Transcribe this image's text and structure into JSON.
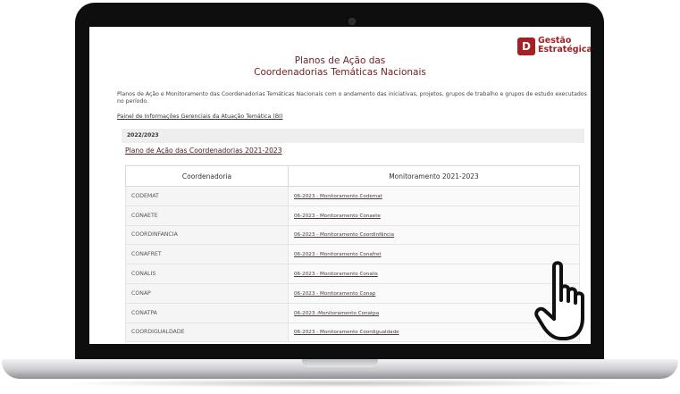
{
  "header": {
    "title_line1": "Planos de Ação das",
    "title_line2": "Coordenadorias Temáticas Nacionais",
    "logo_line1": "Gestão",
    "logo_line2": "Estratégica",
    "logo_mark": "D"
  },
  "intro": {
    "text": "Planos de Ação e Monitoramento das Coordenadorias Temáticas Nacionais com o andamento das iniciativas, projetos, grupos de trabalho e grupos de estudo executados no período.",
    "panel_link": "Painel de Informações Gerenciais da Atuação Temática (BI)"
  },
  "section": {
    "year": "2022/2023",
    "plan_link": "Plano de Ação das Coordenadorias 2021-2023"
  },
  "table": {
    "headers": [
      "Coordenadoria",
      "Monitoramento 2021-2023"
    ],
    "rows": [
      {
        "name": "CODEMAT",
        "link": "06-2023 - Monitoramento Codemat"
      },
      {
        "name": "CONAETE",
        "link": "06-2023 - Monitoramento Conaete"
      },
      {
        "name": "COORDINFANCIA",
        "link": "06-2023 - Monitoramento Coordinfância"
      },
      {
        "name": "CONAFRET",
        "link": "06-2023 - Monitoramento Conafret"
      },
      {
        "name": "CONALIS",
        "link": "06-2023 - Monitoramento Conalis"
      },
      {
        "name": "CONAP",
        "link": "06-2023 - Monitoramento Conap"
      },
      {
        "name": "CONATPA",
        "link": "06-2023 -Monitoramento Conatpa"
      },
      {
        "name": "COORDIGUALDADE",
        "link": "06-2023 - Monitoramento Coordigualdade"
      }
    ]
  },
  "colors": {
    "brand": "#a32024",
    "title": "#6e1f22"
  }
}
